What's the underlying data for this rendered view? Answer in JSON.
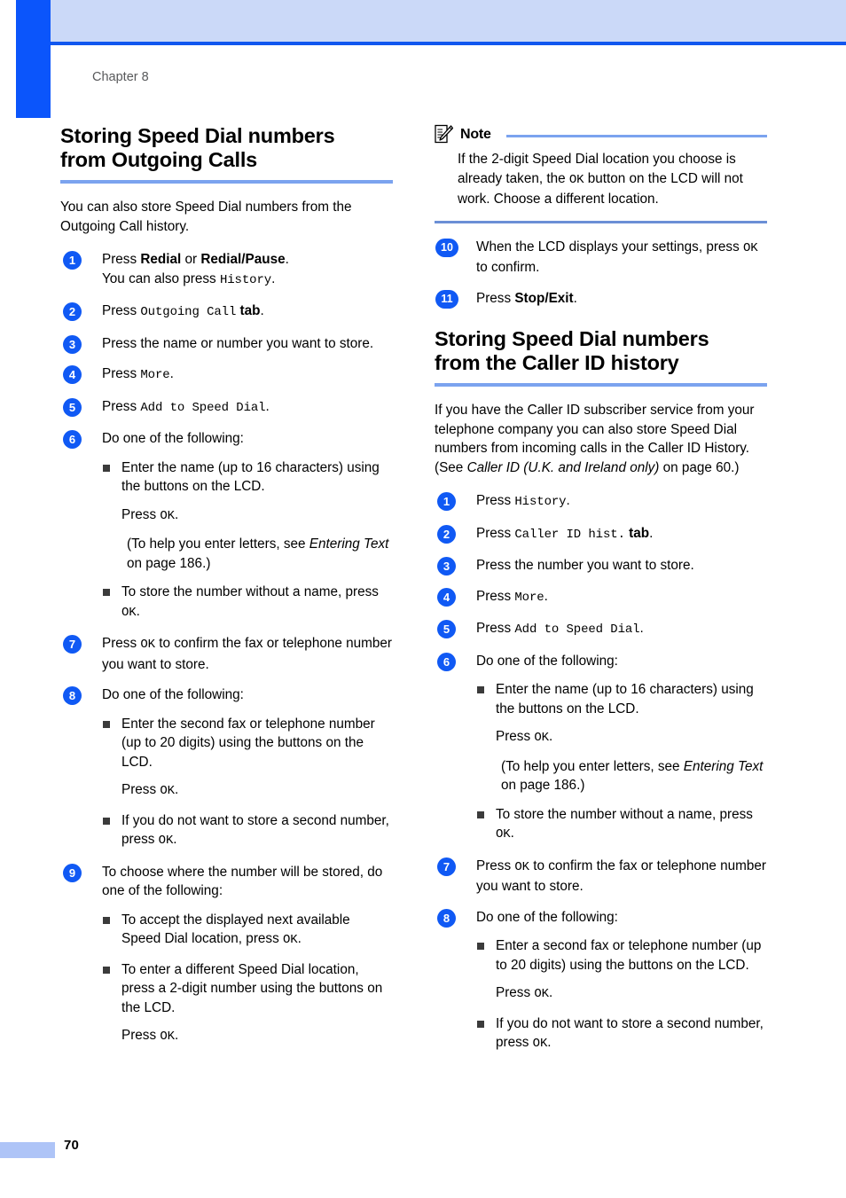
{
  "page": {
    "chapter_label": "Chapter 8",
    "page_number": "70",
    "accent_blue": "#0b55fb",
    "header_band_blue": "#cbd9f8",
    "rule_blue": "#7ba3ef",
    "badge_blue": "#1059f4"
  },
  "left_column": {
    "section": {
      "title_line1": "Storing Speed Dial numbers",
      "title_line2": "from Outgoing Calls",
      "intro": "You can also store Speed Dial numbers from the Outgoing Call history."
    },
    "steps": [
      {
        "number": "1",
        "text_a": "Press ",
        "bold_a": "Redial",
        "text_b": " or ",
        "bold_b": "Redial/Pause",
        "text_c": ".",
        "line2_a": "You can also press ",
        "line2_lcd": "History",
        "line2_b": "."
      },
      {
        "number": "2",
        "text_a": "Press ",
        "lcd_a": "Outgoing Call",
        "bold_b": " tab",
        "text_c": "."
      },
      {
        "number": "3",
        "text": "Press the name or number you want to store."
      },
      {
        "number": "4",
        "text_a": "Press ",
        "lcd_a": "More",
        "text_c": "."
      },
      {
        "number": "5",
        "text_a": "Press ",
        "lcd_a": "Add to Speed Dial",
        "text_c": "."
      },
      {
        "number": "6",
        "text": "Do one of the following:",
        "bullets": [
          {
            "text": "Enter the name (up to 16 characters) using the buttons on the LCD.",
            "follow1_a": "Press ",
            "follow1_lcd": "OK",
            "follow1_b": ".",
            "follow2_plain": " (To help you enter letters, see ",
            "follow2_ital": "Entering Text",
            "follow2_tail": " on page 186.)"
          },
          {
            "text_a": "To store the number without a name, press ",
            "lcd_a": "OK",
            "text_b": "."
          }
        ]
      },
      {
        "number": "7",
        "text_a": "Press ",
        "lcd_a": "OK",
        "text_b": " to confirm the fax or telephone number you want to store."
      },
      {
        "number": "8",
        "text": "Do one of the following:",
        "bullets": [
          {
            "text": "Enter the second fax or telephone number (up to 20 digits) using the buttons on the LCD.",
            "follow1_a": "Press ",
            "follow1_lcd": "OK",
            "follow1_b": "."
          },
          {
            "text_a": "If you do not want to store a second number, press ",
            "lcd_a": "OK",
            "text_b": "."
          }
        ]
      },
      {
        "number": "9",
        "text": "To choose where the number will be stored, do one of the following:",
        "bullets": [
          {
            "text_a": "To accept the displayed next available Speed Dial location, press ",
            "lcd_a": "OK",
            "text_b": "."
          },
          {
            "text": "To enter a different Speed Dial location, press a 2-digit number using the buttons on the LCD.",
            "follow1_a": "Press ",
            "follow1_lcd": "OK",
            "follow1_b": "."
          }
        ]
      }
    ]
  },
  "right_column": {
    "note": {
      "title": "Note",
      "icon": "note-pencil-icon",
      "body_a": "If the 2-digit Speed Dial location you choose is already taken, the ",
      "body_lcd": "OK",
      "body_b": " button on the LCD will not work. Choose a different location."
    },
    "steps_continued": [
      {
        "number": "10",
        "text_a": "When the LCD displays your settings, press ",
        "lcd_a": "OK",
        "text_b": " to confirm."
      },
      {
        "number": "11",
        "text_a": "Press ",
        "bold_a": "Stop/Exit",
        "text_b": "."
      }
    ],
    "section": {
      "title_line1": "Storing Speed Dial numbers",
      "title_line2": "from the Caller ID history",
      "intro_a": "If you have the Caller ID subscriber service from your telephone company you can also store Speed Dial numbers from incoming calls in the Caller ID History. (See ",
      "intro_ital": "Caller ID (U.K. and Ireland only)",
      "intro_b": " on page 60.)"
    },
    "steps": [
      {
        "number": "1",
        "text_a": "Press ",
        "lcd_a": "History",
        "text_c": "."
      },
      {
        "number": "2",
        "text_a": "Press ",
        "lcd_a": "Caller ID hist.",
        "bold_b": " tab",
        "text_c": "."
      },
      {
        "number": "3",
        "text": "Press the number you want to store."
      },
      {
        "number": "4",
        "text_a": "Press ",
        "lcd_a": "More",
        "text_c": "."
      },
      {
        "number": "5",
        "text_a": "Press ",
        "lcd_a": "Add to Speed Dial",
        "text_c": "."
      },
      {
        "number": "6",
        "text": "Do one of the following:",
        "bullets": [
          {
            "text": "Enter the name (up to 16 characters) using the buttons on the LCD.",
            "follow1_a": "Press ",
            "follow1_lcd": "OK",
            "follow1_b": ".",
            "follow2_plain": " (To help you enter letters, see ",
            "follow2_ital": "Entering Text",
            "follow2_tail": " on page 186.)"
          },
          {
            "text_a": "To store the number without a name, press ",
            "lcd_a": "OK",
            "text_b": "."
          }
        ]
      },
      {
        "number": "7",
        "text_a": "Press ",
        "lcd_a": "OK",
        "text_b": " to confirm the fax or telephone number you want to store."
      },
      {
        "number": "8",
        "text": "Do one of the following:",
        "bullets": [
          {
            "text": "Enter a second fax or telephone number (up to 20 digits) using the buttons on the LCD.",
            "follow1_a": "Press ",
            "follow1_lcd": "OK",
            "follow1_b": "."
          },
          {
            "text_a": "If you do not want to store a second number, press ",
            "lcd_a": "OK",
            "text_b": "."
          }
        ]
      }
    ]
  }
}
